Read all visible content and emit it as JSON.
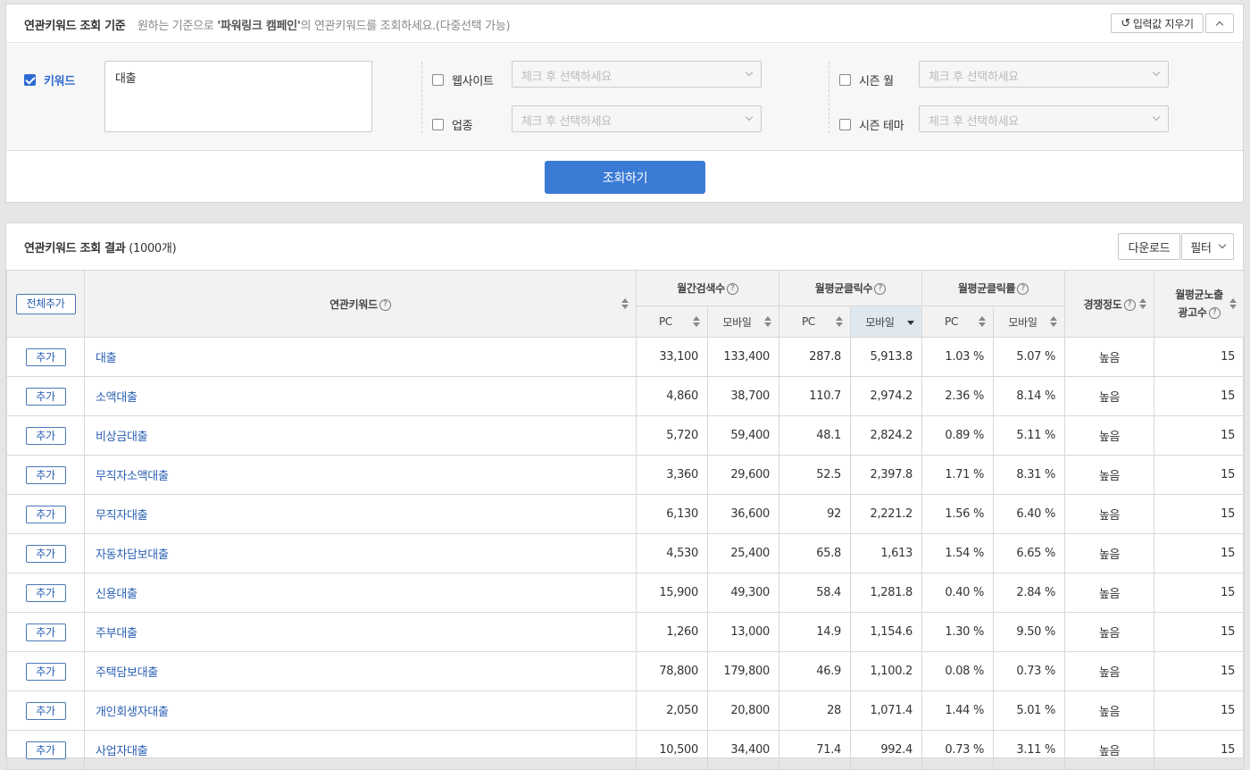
{
  "criteria": {
    "title": "연관키워드 조회 기준",
    "desc_prefix": "원하는 기준으로 ",
    "desc_bold": "'파워링크 캠페인'",
    "desc_suffix": "의 연관키워드를 조회하세요.(다중선택 가능)",
    "reset_label": "입력값 지우기",
    "keyword_label": "키워드",
    "keyword_value": "대출",
    "website_label": "웹사이트",
    "industry_label": "업종",
    "season_month_label": "시즌 월",
    "season_theme_label": "시즌 테마",
    "select_placeholder": "체크 후 선택하세요",
    "search_label": "조회하기"
  },
  "results": {
    "title": "연관키워드 조회 결과",
    "count": "(1000개)",
    "download_label": "다운로드",
    "filter_label": "필터",
    "add_all_label": "전체추가",
    "add_label": "추가",
    "headers": {
      "keyword": "연관키워드",
      "monthly_search": "월간검색수",
      "monthly_clicks": "월평균클릭수",
      "monthly_ctr": "월평균클릭률",
      "competition": "경쟁정도",
      "ad_count_1": "월평균노출",
      "ad_count_2": "광고수",
      "pc": "PC",
      "mobile": "모바일"
    },
    "rows": [
      {
        "kw": "대출",
        "s_pc": "33,100",
        "s_mo": "133,400",
        "c_pc": "287.8",
        "c_mo": "5,913.8",
        "r_pc": "1.03 %",
        "r_mo": "5.07 %",
        "comp": "높음",
        "ads": "15"
      },
      {
        "kw": "소액대출",
        "s_pc": "4,860",
        "s_mo": "38,700",
        "c_pc": "110.7",
        "c_mo": "2,974.2",
        "r_pc": "2.36 %",
        "r_mo": "8.14 %",
        "comp": "높음",
        "ads": "15"
      },
      {
        "kw": "비상금대출",
        "s_pc": "5,720",
        "s_mo": "59,400",
        "c_pc": "48.1",
        "c_mo": "2,824.2",
        "r_pc": "0.89 %",
        "r_mo": "5.11 %",
        "comp": "높음",
        "ads": "15"
      },
      {
        "kw": "무직자소액대출",
        "s_pc": "3,360",
        "s_mo": "29,600",
        "c_pc": "52.5",
        "c_mo": "2,397.8",
        "r_pc": "1.71 %",
        "r_mo": "8.31 %",
        "comp": "높음",
        "ads": "15"
      },
      {
        "kw": "무직자대출",
        "s_pc": "6,130",
        "s_mo": "36,600",
        "c_pc": "92",
        "c_mo": "2,221.2",
        "r_pc": "1.56 %",
        "r_mo": "6.40 %",
        "comp": "높음",
        "ads": "15"
      },
      {
        "kw": "자동차담보대출",
        "s_pc": "4,530",
        "s_mo": "25,400",
        "c_pc": "65.8",
        "c_mo": "1,613",
        "r_pc": "1.54 %",
        "r_mo": "6.65 %",
        "comp": "높음",
        "ads": "15"
      },
      {
        "kw": "신용대출",
        "s_pc": "15,900",
        "s_mo": "49,300",
        "c_pc": "58.4",
        "c_mo": "1,281.8",
        "r_pc": "0.40 %",
        "r_mo": "2.84 %",
        "comp": "높음",
        "ads": "15"
      },
      {
        "kw": "주부대출",
        "s_pc": "1,260",
        "s_mo": "13,000",
        "c_pc": "14.9",
        "c_mo": "1,154.6",
        "r_pc": "1.30 %",
        "r_mo": "9.50 %",
        "comp": "높음",
        "ads": "15"
      },
      {
        "kw": "주택담보대출",
        "s_pc": "78,800",
        "s_mo": "179,800",
        "c_pc": "46.9",
        "c_mo": "1,100.2",
        "r_pc": "0.08 %",
        "r_mo": "0.73 %",
        "comp": "높음",
        "ads": "15"
      },
      {
        "kw": "개인회생자대출",
        "s_pc": "2,050",
        "s_mo": "20,800",
        "c_pc": "28",
        "c_mo": "1,071.4",
        "r_pc": "1.44 %",
        "r_mo": "5.01 %",
        "comp": "높음",
        "ads": "15"
      },
      {
        "kw": "사업자대출",
        "s_pc": "10,500",
        "s_mo": "34,400",
        "c_pc": "71.4",
        "c_mo": "992.4",
        "r_pc": "0.73 %",
        "r_mo": "3.11 %",
        "comp": "높음",
        "ads": "15"
      }
    ]
  },
  "colors": {
    "accent": "#3a7bd5",
    "link": "#2a5fb3"
  }
}
